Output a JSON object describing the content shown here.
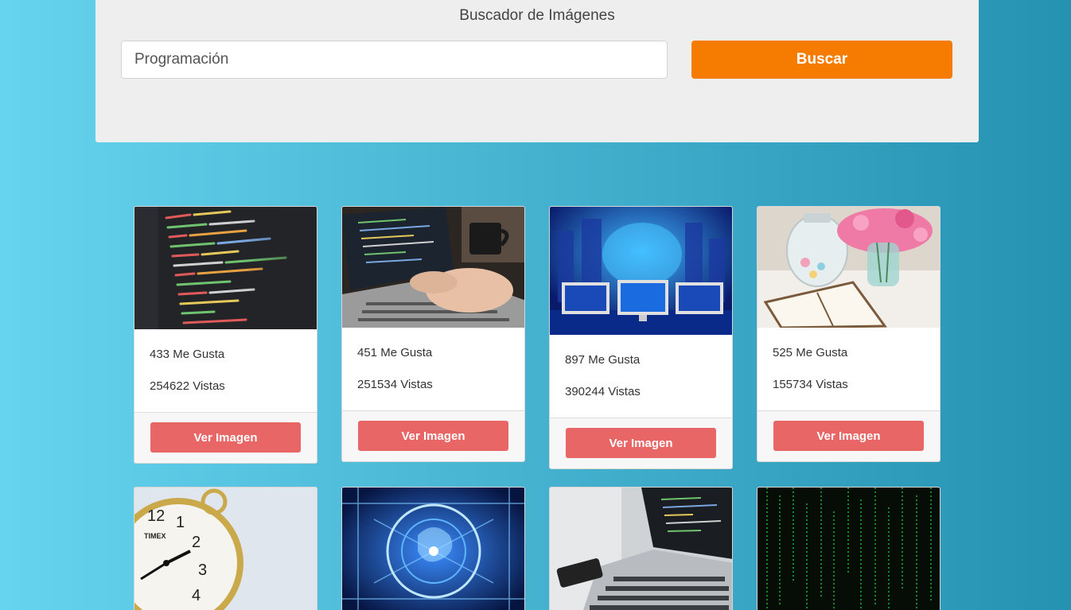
{
  "header": {
    "title": "Buscador de Imágenes",
    "search_value": "Programación",
    "search_button": "Buscar"
  },
  "cards": [
    {
      "likes": "433 Me Gusta",
      "views": "254622 Vistas",
      "button": "Ver Imagen",
      "image": "code-editor-photo"
    },
    {
      "likes": "451 Me Gusta",
      "views": "251534 Vistas",
      "button": "Ver Imagen",
      "image": "laptop-typing-photo"
    },
    {
      "likes": "897 Me Gusta",
      "views": "390244 Vistas",
      "button": "Ver Imagen",
      "image": "monitors-network-photo"
    },
    {
      "likes": "525 Me Gusta",
      "views": "155734 Vistas",
      "button": "Ver Imagen",
      "image": "desk-flowers-notebook-photo"
    },
    {
      "image": "alarm-clock-photo"
    },
    {
      "image": "circuit-brain-photo"
    },
    {
      "image": "laptop-phone-photo"
    },
    {
      "image": "matrix-code-photo"
    }
  ],
  "colors": {
    "accent_orange": "#f57c00",
    "button_red": "#e96666",
    "panel_bg": "#eeeeee"
  }
}
